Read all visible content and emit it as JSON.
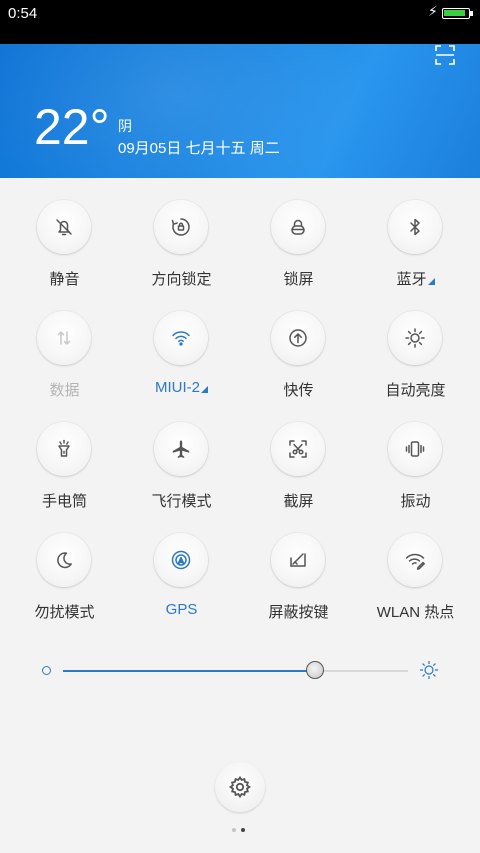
{
  "status_bar": {
    "time": "0:54",
    "battery_level": 0.9,
    "charging": true
  },
  "header": {
    "temperature": "22°",
    "weather": "阴",
    "date": "09月05日 七月十五 周二"
  },
  "tiles": [
    {
      "label": "静音",
      "icon": "bell-off-icon",
      "state": "normal"
    },
    {
      "label": "方向锁定",
      "icon": "rotation-lock-icon",
      "state": "normal"
    },
    {
      "label": "锁屏",
      "icon": "lock-icon",
      "state": "normal"
    },
    {
      "label": "蓝牙",
      "icon": "bluetooth-icon",
      "state": "normal",
      "has_menu": true
    },
    {
      "label": "数据",
      "icon": "mobile-data-icon",
      "state": "disabled"
    },
    {
      "label": "MIUI-2",
      "icon": "wifi-icon",
      "state": "active",
      "has_menu": true
    },
    {
      "label": "快传",
      "icon": "share-icon",
      "state": "normal"
    },
    {
      "label": "自动亮度",
      "icon": "auto-brightness-icon",
      "state": "normal"
    },
    {
      "label": "手电筒",
      "icon": "flashlight-icon",
      "state": "normal"
    },
    {
      "label": "飞行模式",
      "icon": "airplane-icon",
      "state": "normal"
    },
    {
      "label": "截屏",
      "icon": "screenshot-icon",
      "state": "normal"
    },
    {
      "label": "振动",
      "icon": "vibrate-icon",
      "state": "normal"
    },
    {
      "label": "勿扰模式",
      "icon": "moon-icon",
      "state": "normal"
    },
    {
      "label": "GPS",
      "icon": "gps-icon",
      "state": "active"
    },
    {
      "label": "屏蔽按键",
      "icon": "block-keys-icon",
      "state": "normal"
    },
    {
      "label": "WLAN 热点",
      "icon": "hotspot-icon",
      "state": "normal"
    }
  ],
  "brightness": {
    "level": 0.73,
    "min_icon": "brightness-low-icon",
    "max_icon": "brightness-high-icon"
  },
  "settings_button": {
    "icon": "gear-icon"
  },
  "pager": {
    "pages": 2,
    "current": 2
  },
  "colors": {
    "accent": "#2c79c6",
    "header_blue": "#1b86e2",
    "disabled": "#b4b4b4"
  }
}
